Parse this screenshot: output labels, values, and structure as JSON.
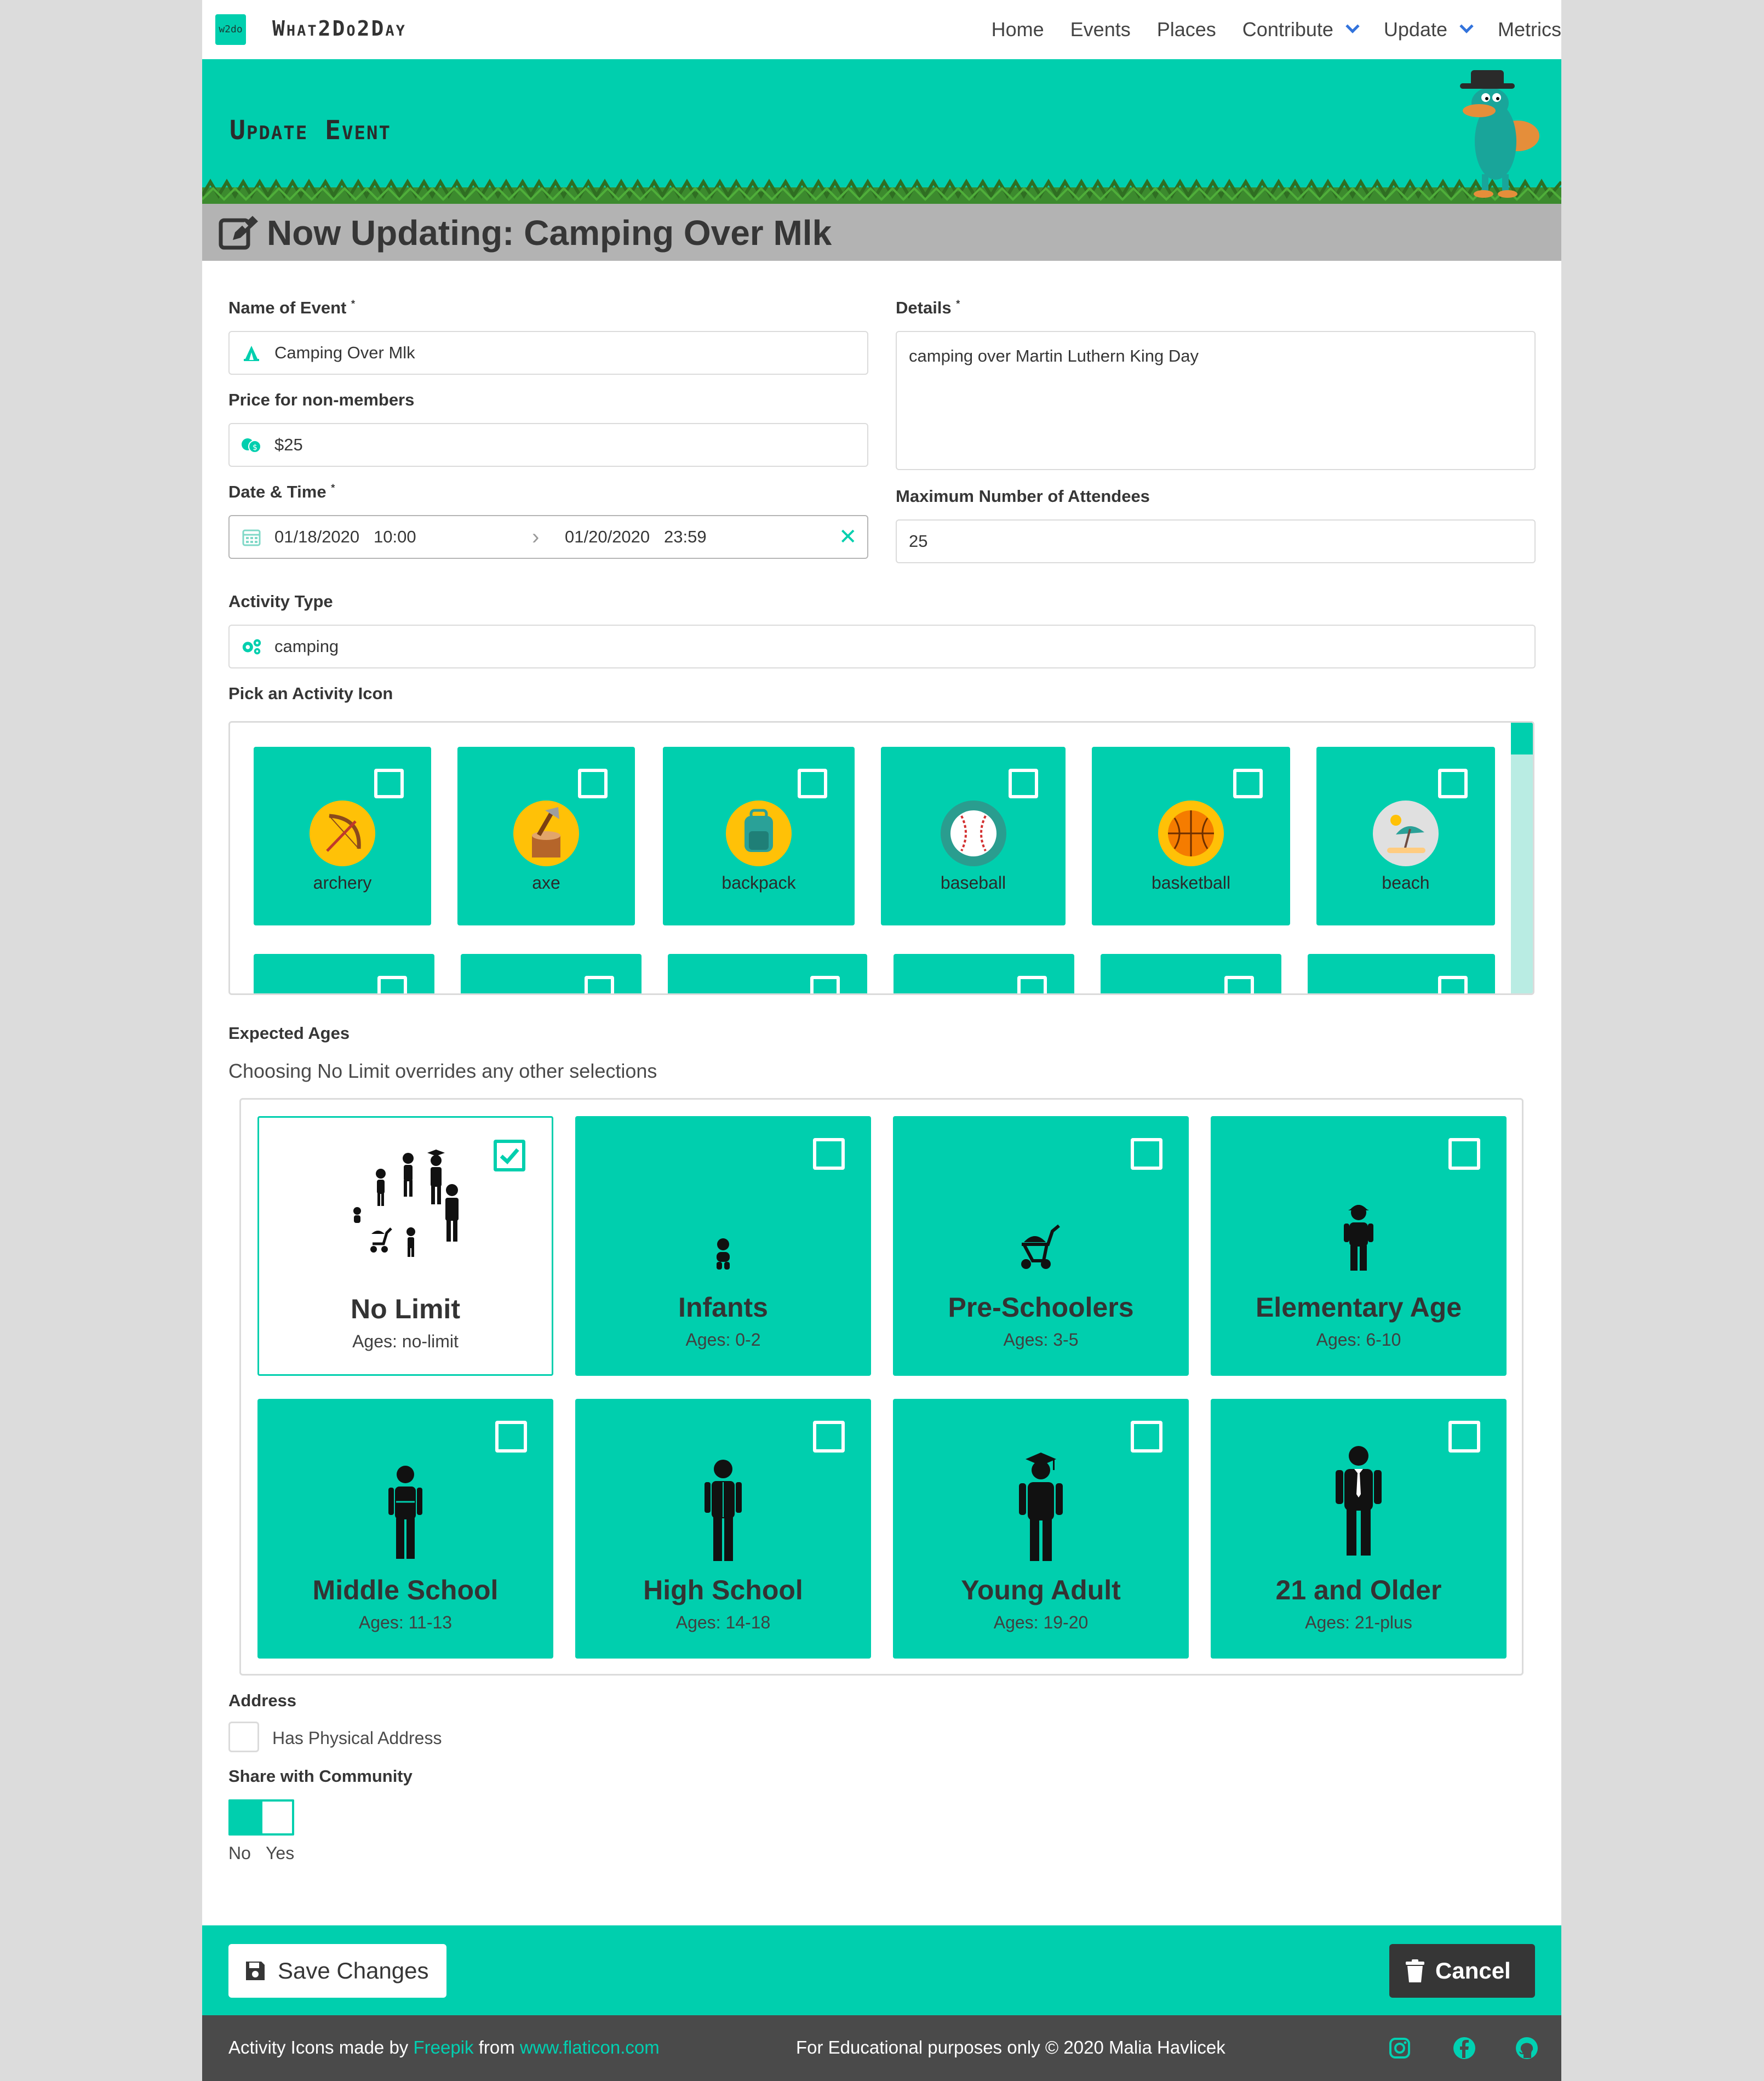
{
  "nav": {
    "logo_text": "w2do",
    "brand": "What2Do2Day",
    "links": [
      "Home",
      "Events",
      "Places",
      "Contribute",
      "Update",
      "Metrics"
    ]
  },
  "hero": {
    "title": "Update Event"
  },
  "subheader": {
    "title": "Now Updating: Camping Over Mlk",
    "icon": "edit-icon"
  },
  "form": {
    "name": {
      "label": "Name of Event",
      "value": "Camping Over Mlk",
      "icon": "tent-icon"
    },
    "price": {
      "label": "Price for non-members",
      "value": "$25",
      "icon": "money-icon"
    },
    "datetime": {
      "label": "Date & Time",
      "start": "01/18/2020   10:00",
      "end": "01/20/2020   23:59",
      "icon": "calendar-icon"
    },
    "details": {
      "label": "Details",
      "value": "camping over Martin Luthern King Day"
    },
    "max_attendees": {
      "label": "Maximum Number of Attendees",
      "value": "25"
    },
    "activity_type": {
      "label": "Activity Type",
      "value": "camping",
      "icon": "cogs-icon"
    },
    "required_mark": "*",
    "activity_icon_label": "Pick an Activity Icon",
    "activity_icons": [
      {
        "label": "archery",
        "icon": "archery-icon",
        "color": "#ffc107"
      },
      {
        "label": "axe",
        "icon": "axe-icon",
        "color": "#ffc107"
      },
      {
        "label": "backpack",
        "icon": "backpack-icon",
        "color": "#ffc107"
      },
      {
        "label": "baseball",
        "icon": "baseball-icon",
        "color": "#2a9d8f"
      },
      {
        "label": "basketball",
        "icon": "basketball-icon",
        "color": "#ffc107"
      },
      {
        "label": "beach",
        "icon": "beach-icon",
        "color": "#e0e0e0"
      }
    ],
    "expected_ages_label": "Expected Ages",
    "ages_help": "Choosing No Limit overrides any other selections",
    "ages": [
      {
        "title": "No Limit",
        "sub": "Ages: no-limit",
        "checked": true
      },
      {
        "title": "Infants",
        "sub": "Ages: 0-2",
        "checked": false
      },
      {
        "title": "Pre-Schoolers",
        "sub": "Ages: 3-5",
        "checked": false
      },
      {
        "title": "Elementary Age",
        "sub": "Ages: 6-10",
        "checked": false
      },
      {
        "title": "Middle School",
        "sub": "Ages: 11-13",
        "checked": false
      },
      {
        "title": "High School",
        "sub": "Ages: 14-18",
        "checked": false
      },
      {
        "title": "Young Adult",
        "sub": "Ages: 19-20",
        "checked": false
      },
      {
        "title": "21 and Older",
        "sub": "Ages: 21-plus",
        "checked": false
      }
    ],
    "address_label": "Address",
    "has_address_label": "Has Physical Address",
    "share_label": "Share with Community",
    "toggle_no": "No",
    "toggle_yes": "Yes"
  },
  "actions": {
    "save": "Save Changes",
    "cancel": "Cancel"
  },
  "footer": {
    "credit_prefix": "Activity Icons made by",
    "credit_author": "Freepik",
    "credit_from": "from",
    "credit_site": "www.flaticon.com",
    "copyright": "For Educational purposes only © 2020 Malia Havlicek"
  },
  "colors": {
    "accent": "#00cfae",
    "dark": "#363636",
    "footer": "#4a4a4a"
  }
}
